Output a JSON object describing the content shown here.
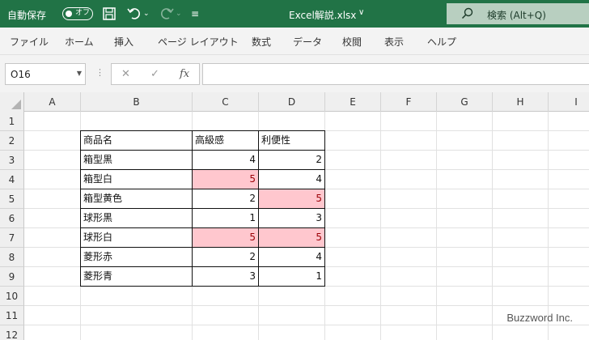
{
  "titlebar": {
    "autosave_label": "自動保存",
    "autosave_state": "オフ",
    "document_title": "Excel解説.xlsx",
    "search_label": "検索 (Alt+Q)"
  },
  "ribbon": {
    "tabs": [
      "ファイル",
      "ホーム",
      "挿入",
      "ページ レイアウト",
      "数式",
      "データ",
      "校閲",
      "表示",
      "ヘルプ"
    ]
  },
  "formula_bar": {
    "name_box": "O16",
    "fx_label": "fx",
    "formula": ""
  },
  "sheet": {
    "columns": [
      "A",
      "B",
      "C",
      "D",
      "E",
      "F",
      "G",
      "H",
      "I"
    ],
    "rows": [
      "1",
      "2",
      "3",
      "4",
      "5",
      "6",
      "7",
      "8",
      "9",
      "10",
      "11",
      "12"
    ],
    "table": {
      "headers": [
        "商品名",
        "高級感",
        "利便性"
      ],
      "rows": [
        {
          "name": "箱型黒",
          "quality": "4",
          "convenience": "2"
        },
        {
          "name": "箱型白",
          "quality": "5",
          "convenience": "4"
        },
        {
          "name": "箱型黄色",
          "quality": "2",
          "convenience": "5"
        },
        {
          "name": "球形黒",
          "quality": "1",
          "convenience": "3"
        },
        {
          "name": "球形白",
          "quality": "5",
          "convenience": "5"
        },
        {
          "name": "菱形赤",
          "quality": "2",
          "convenience": "4"
        },
        {
          "name": "菱形青",
          "quality": "3",
          "convenience": "1"
        }
      ]
    }
  },
  "watermark": "Buzzword Inc.",
  "colors": {
    "title_bar": "#217346",
    "highlight_fill": "#ffc7ce",
    "highlight_text": "#9c0006"
  }
}
